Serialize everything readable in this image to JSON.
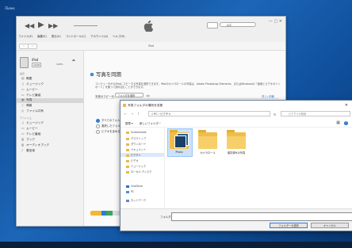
{
  "desktop": {
    "title": "iTunes"
  },
  "itunes": {
    "menubar": [
      "ファイル(F)",
      "編集(E)",
      "表示(V)",
      "コントロール(C)",
      "アカウント(A)",
      "ヘルプ(H)"
    ],
    "search_placeholder": "検索",
    "nav_title": "iPad",
    "device": {
      "name": "iPad",
      "capacity": "16GB",
      "battery": "100%"
    },
    "sidebar": {
      "settings_header": "設定",
      "settings": [
        {
          "label": "概要",
          "icon": "summary-icon"
        },
        {
          "label": "ミュージック",
          "icon": "music-icon"
        },
        {
          "label": "ムービー",
          "icon": "movie-icon"
        },
        {
          "label": "テレビ番組",
          "icon": "tv-icon"
        },
        {
          "label": "写真",
          "icon": "photos-icon",
          "active": true
        },
        {
          "label": "情報",
          "icon": "info-icon"
        },
        {
          "label": "ファイル共有",
          "icon": "file-share-icon"
        }
      ],
      "device_header": "デバイス上",
      "device_items": [
        {
          "label": "ミュージック",
          "icon": "music-icon"
        },
        {
          "label": "ムービー",
          "icon": "movie-icon"
        },
        {
          "label": "テレビ番組",
          "icon": "tv-icon"
        },
        {
          "label": "ブック",
          "icon": "book-icon"
        },
        {
          "label": "オーディオブック",
          "icon": "audiobook-icon"
        },
        {
          "label": "着信音",
          "icon": "ringtone-icon"
        }
      ]
    },
    "main": {
      "sync_title": "写真を同期",
      "desc": "コンピュータからiPadにコピーする写真を選択できます。iPadのカメラロールの写真は、Adobe Photoshop Elements、またはWindowsの「画像とビデオのインポート」を使って読み込むことができます。",
      "copy_label": "写真のコピー元:",
      "copy_value": "フォルダを選択",
      "count": "0枚",
      "detail_link": "詳しい情報",
      "options": [
        "すべてのフォルダ",
        "選択したフォルダ",
        "ビデオを含める"
      ],
      "capacity_colors": [
        "#f3b731",
        "#2f7bdd",
        "#3aa757"
      ]
    }
  },
  "dialog": {
    "title": "写真フォルダの場所を変更",
    "address": "« PC › ピクチャ",
    "search_placeholder": "ピクチャの検索",
    "cmd_organize": "整理 ▾",
    "cmd_newfolder": "新しいフォルダー",
    "tree": [
      "Screenshots",
      "デスクトップ",
      "ダウンロード",
      "ドキュメント",
      "ピクチャ",
      "ビデオ",
      "ミュージック",
      "ローカル ディスク",
      "OneDrive",
      "PC",
      "ネットワーク"
    ],
    "folders": [
      {
        "label": "Photo",
        "type": "photo"
      },
      {
        "label": "カメラロール",
        "type": "plain"
      },
      {
        "label": "保存済みの写真",
        "type": "plain"
      }
    ],
    "filename_label": "フォルダー:",
    "filename_value": "",
    "ok_label": "フォルダーの選択",
    "cancel_label": "キャンセル"
  }
}
